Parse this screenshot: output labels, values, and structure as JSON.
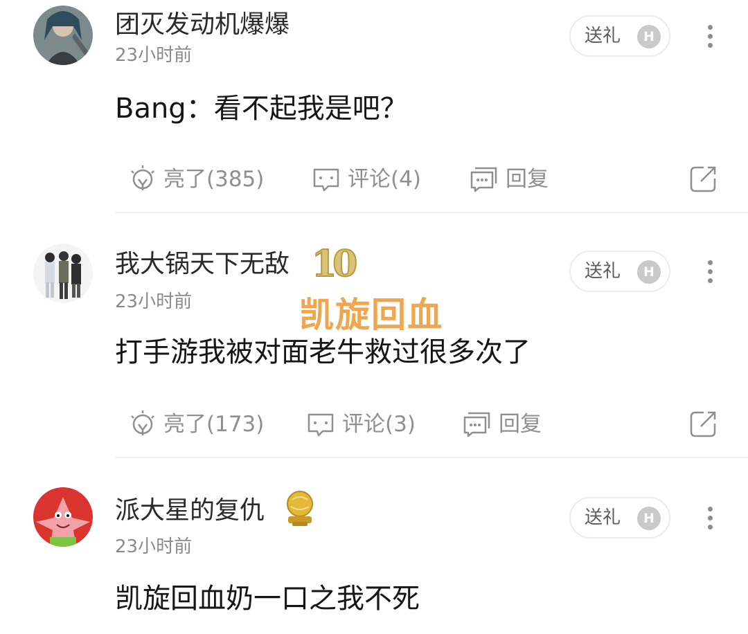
{
  "comments": [
    {
      "username": "团灭发动机爆爆",
      "time": "23小时前",
      "gift_label": "送礼",
      "gift_coin": "H",
      "content": "Bang：看不起我是吧？",
      "likes_label": "亮了(385)",
      "comments_label": "评论(4)",
      "reply_label": "回复",
      "avatar_icon": "anime-character-avatar"
    },
    {
      "username": "我大锅天下无敌",
      "badge": "10",
      "time": "23小时前",
      "gift_label": "送礼",
      "gift_coin": "H",
      "content": "打手游我被对面老牛救过很多次了",
      "likes_label": "亮了(173)",
      "comments_label": "评论(3)",
      "reply_label": "回复",
      "avatar_icon": "group-of-people-avatar"
    },
    {
      "username": "派大星的复仇",
      "badge_icon": "golden-ball-medal-icon",
      "time": "23小时前",
      "gift_label": "送礼",
      "gift_coin": "H",
      "content": "凯旋回血奶一口之我不死",
      "avatar_icon": "patrick-star-avatar"
    }
  ],
  "overlay_text": "凯旋回血",
  "colors": {
    "overlay": "#f0a64f",
    "muted": "#8f8f8f",
    "badge_gold": "#d9c27a"
  }
}
